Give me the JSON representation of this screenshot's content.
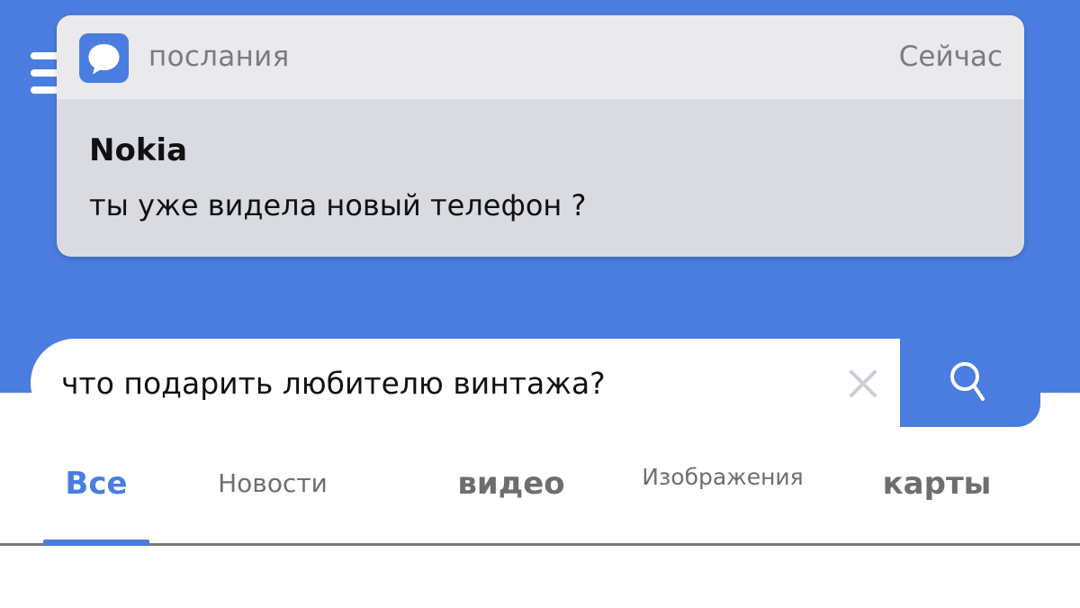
{
  "notification": {
    "app_name": "послания",
    "time": "Сейчас",
    "sender": "Nokia",
    "message": "ты уже видела новый телефон ?",
    "icon": "message-bubble-icon"
  },
  "search": {
    "query": "что подарить любителю винтажа?",
    "clear_icon": "close-icon",
    "submit_icon": "search-icon"
  },
  "tabs": [
    {
      "label": "Все",
      "active": true
    },
    {
      "label": "Новости",
      "active": false
    },
    {
      "label": "видео",
      "active": false
    },
    {
      "label": "Изображения",
      "active": false
    },
    {
      "label": "карты",
      "active": false
    }
  ],
  "colors": {
    "accent": "#4a7ddf",
    "notification_background": "#d9dbe0",
    "notification_header": "#eaeaec",
    "inactive_tab": "#6e6e6e"
  }
}
